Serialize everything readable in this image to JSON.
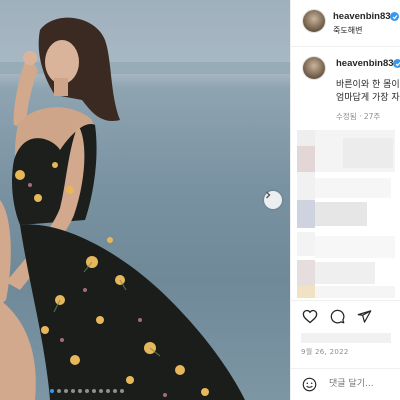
{
  "post_header": {
    "username": "heavenbin83",
    "location": "죽도해변"
  },
  "caption": {
    "username": "heavenbin83",
    "line1": "바른이와 한 몸이",
    "line2": "엄마답게 가장 자",
    "edited": "수정됨",
    "separator": "·",
    "age": "27주"
  },
  "post_date": "9월 26, 2022",
  "comment": {
    "placeholder": "댓글 달기..."
  },
  "carousel": {
    "slide_count": 11,
    "active_index": 0
  },
  "icons": {
    "like": "heart-icon",
    "comment": "comment-icon",
    "share": "share-icon",
    "emoji": "smile-icon",
    "next": "chevron-right-icon",
    "verified": "verified-badge-icon"
  },
  "colors": {
    "verified": "#3897f0",
    "dot_active": "#3a96f0",
    "text_primary": "#262626",
    "text_secondary": "#8e8e8e"
  }
}
